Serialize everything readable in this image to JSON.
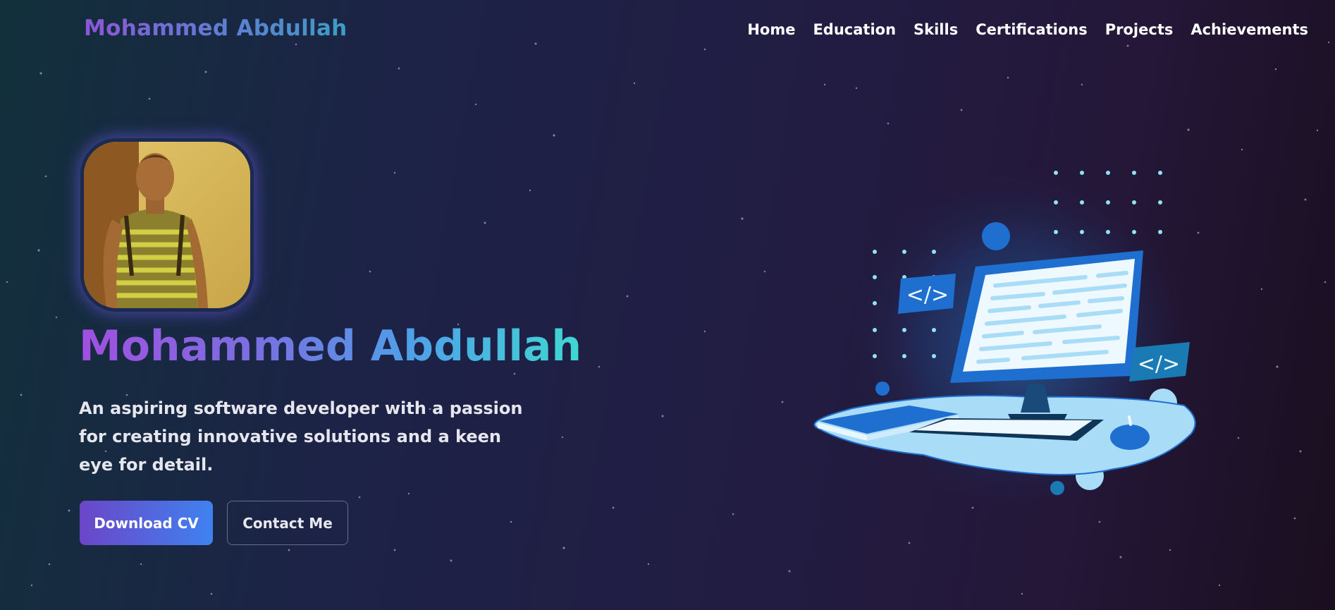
{
  "header": {
    "logo_text": "Mohammed Abdullah",
    "nav": [
      {
        "label": "Home"
      },
      {
        "label": "Education"
      },
      {
        "label": "Skills"
      },
      {
        "label": "Certifications"
      },
      {
        "label": "Projects"
      },
      {
        "label": "Achievements"
      }
    ]
  },
  "hero": {
    "name": "Mohammed Abdullah",
    "tagline": "An aspiring software developer with a passion for creating innovative solutions and a keen eye for detail.",
    "download_cv_label": "Download CV",
    "contact_label": "Contact Me",
    "code_tag_text": "</>"
  },
  "colors": {
    "accent_purple": "#6b46c8",
    "accent_blue": "#3f82f0",
    "accent_cyan": "#3fd8d2",
    "illustration_blue": "#1f6fd0",
    "illustration_light": "#a9dcf7"
  },
  "icons": {
    "avatar": "profile-photo",
    "illustration": "desktop-computer-code-illustration"
  }
}
